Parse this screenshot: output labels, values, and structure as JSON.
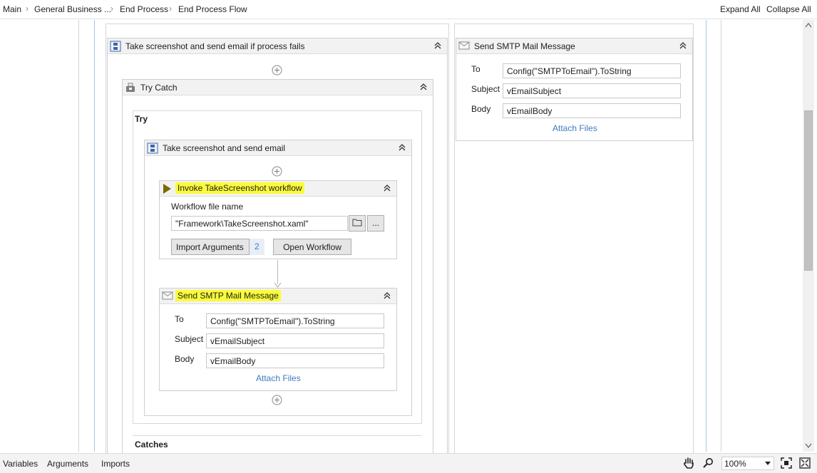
{
  "breadcrumb": {
    "items": [
      "Main",
      "General Business ...",
      "End Process",
      "End Process Flow"
    ]
  },
  "toolbar": {
    "expand_all": "Expand All",
    "collapse_all": "Collapse All"
  },
  "outer_sequence": {
    "title": "Take screenshot and send email if process fails"
  },
  "try_catch": {
    "title": "Try Catch",
    "try_label": "Try",
    "catches_label": "Catches"
  },
  "inner_sequence": {
    "title": "Take screenshot and send email"
  },
  "invoke_workflow": {
    "title": "Invoke TakeScreenshot workflow",
    "file_label": "Workflow file name",
    "file_value": "\"Framework\\TakeScreenshot.xaml\"",
    "browse_button": "...",
    "import_button": "Import Arguments",
    "import_count": "2",
    "open_button": "Open Workflow"
  },
  "smtp_inner": {
    "title": "Send SMTP Mail Message",
    "to_label": "To",
    "to_value": "Config(\"SMTPToEmail\").ToString",
    "subject_label": "Subject",
    "subject_value": "vEmailSubject",
    "body_label": "Body",
    "body_value": "vEmailBody",
    "attach_link": "Attach Files"
  },
  "smtp_right": {
    "title": "Send SMTP Mail Message",
    "to_label": "To",
    "to_value": "Config(\"SMTPToEmail\").ToString",
    "subject_label": "Subject",
    "subject_value": "vEmailSubject",
    "body_label": "Body",
    "body_value": "vEmailBody",
    "attach_link": "Attach Files"
  },
  "bottom": {
    "tabs": [
      "Variables",
      "Arguments",
      "Imports"
    ],
    "zoom": "100%"
  },
  "icons": {
    "sequence": "sequence-icon",
    "try_catch": "try-catch-icon",
    "invoke": "invoke-workflow-icon",
    "mail": "mail-icon",
    "collapse": "collapse-chevron-icon",
    "add": "add-activity-icon",
    "folder": "folder-icon",
    "hand": "hand-pan-icon",
    "search": "zoom-search-icon",
    "fit": "fit-to-screen-icon",
    "reset": "reset-zoom-icon"
  },
  "colors": {
    "highlight": "#fbfb3a",
    "link": "#3f7bbf",
    "header_bg": "#f2f2f2"
  }
}
